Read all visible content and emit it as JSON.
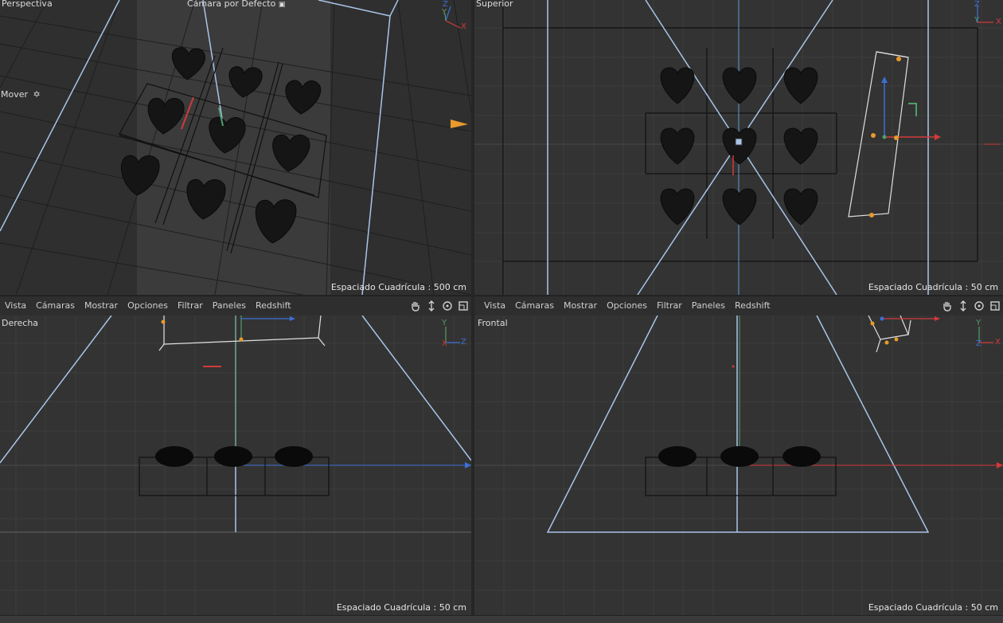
{
  "viewports": {
    "perspective": {
      "name": "Perspectiva",
      "camera": "Cámara por Defecto",
      "tool": "Mover",
      "grid_spacing": "Espaciado Cuadrícula : 500 cm"
    },
    "top": {
      "name": "Superior",
      "grid_spacing": "Espaciado Cuadrícula : 50 cm"
    },
    "right": {
      "name": "Derecha",
      "grid_spacing": "Espaciado Cuadrícula : 50 cm"
    },
    "front": {
      "name": "Frontal",
      "grid_spacing": "Espaciado Cuadrícula : 50 cm"
    }
  },
  "menubar_left": {
    "items": [
      "Vista",
      "Cámaras",
      "Mostrar",
      "Opciones",
      "Filtrar",
      "Paneles",
      "Redshift"
    ]
  },
  "menubar_right": {
    "items": [
      "Vista",
      "Cámaras",
      "Mostrar",
      "Opciones",
      "Filtrar",
      "Paneles",
      "Redshift"
    ]
  },
  "navigation_icons": [
    "pan-hand-icon",
    "move-view-icon",
    "rotate-view-icon",
    "maximize-view-icon"
  ],
  "axis_labels": {
    "x": "X",
    "y": "Y",
    "z": "Z"
  },
  "colors": {
    "viewport_bg": "#333333",
    "grid": "#3e3e3e",
    "camera_lines": "#a9c4e8",
    "x_axis": "#d23a3a",
    "y_axis": "#4f9e6a",
    "z_axis": "#3d6fd6",
    "accent_orange": "#e89a2a"
  }
}
